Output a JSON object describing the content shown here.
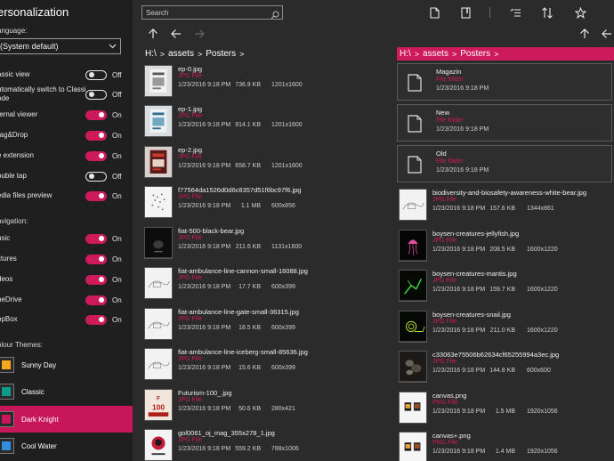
{
  "sidebar": {
    "title": "ersonalization",
    "language_label": "anguage:",
    "language_value": "(System default)",
    "options": [
      {
        "label": "assic view",
        "state": "Off",
        "on": false
      },
      {
        "label": "utomatically switch to Classic\node",
        "state": "Off",
        "on": false
      },
      {
        "label": "ternal viewer",
        "state": "On",
        "on": true
      },
      {
        "label": "rag&Drop",
        "state": "On",
        "on": true
      },
      {
        "label": "e extension",
        "state": "On",
        "on": true
      },
      {
        "label": "ouble tap",
        "state": "Off",
        "on": false
      },
      {
        "label": "edia files preview",
        "state": "On",
        "on": true
      }
    ],
    "navigation_label": "avigation:",
    "navigation": [
      {
        "label": "usic",
        "state": "On",
        "on": true
      },
      {
        "label": "ctures",
        "state": "On",
        "on": true
      },
      {
        "label": "deos",
        "state": "On",
        "on": true
      },
      {
        "label": "neDrive",
        "state": "On",
        "on": true
      },
      {
        "label": "opBox",
        "state": "On",
        "on": true
      }
    ],
    "themes_label": "olour Themes:",
    "themes": [
      {
        "name": "Sunny Day",
        "color": "#f5a81c",
        "selected": false
      },
      {
        "name": "Classic",
        "color": "#0f9c8c",
        "selected": false
      },
      {
        "name": "Dark Knight",
        "color": "#c8165a",
        "selected": true
      },
      {
        "name": "Cool Water",
        "color": "#2e8ee0",
        "selected": false
      }
    ]
  },
  "toolbar": {
    "search_placeholder": "Search",
    "icons": [
      "new-file-icon",
      "new-window-icon",
      "select-list-icon",
      "sort-icon",
      "favorite-star-icon"
    ]
  },
  "accent": "#cc1a5a",
  "left_pane": {
    "breadcrumb": [
      "H:\\",
      "assets",
      "Posters"
    ],
    "files": [
      {
        "name": "ep-0.jpg",
        "type": "JPG File",
        "date": "1/23/2016 9:18 PM",
        "size": "736.9 KB",
        "dims": "1201x1600",
        "art": "poster-grey"
      },
      {
        "name": "ep-1.jpg",
        "type": "JPG File",
        "date": "1/23/2016 9:18 PM",
        "size": "914.1 KB",
        "dims": "1201x1600",
        "art": "poster-blue"
      },
      {
        "name": "ep-2.jpg",
        "type": "JPG File",
        "date": "1/23/2016 9:18 PM",
        "size": "658.7 KB",
        "dims": "1201x1600",
        "art": "poster-red"
      },
      {
        "name": "f77564da1526d0d6c8357d51f6bc97f6.jpg",
        "type": "JPG File",
        "date": "1/23/2016 9:18 PM",
        "size": "1.1 MB",
        "dims": "600x856",
        "art": "poster-dots"
      },
      {
        "name": "fiat-500-black-bear.jpg",
        "type": "JPG File",
        "date": "1/23/2016 9:18 PM",
        "size": "211.6 KB",
        "dims": "1131x1600",
        "art": "poster-dark"
      },
      {
        "name": "fiat-ambulance-line-cannon-small-16088.jpg",
        "type": "JPG File",
        "date": "1/23/2016 9:18 PM",
        "size": "17.7 KB",
        "dims": "600x399",
        "art": "sketch"
      },
      {
        "name": "fiat-ambulance-line-gate-small-36315.jpg",
        "type": "JPG File",
        "date": "1/23/2016 9:18 PM",
        "size": "18.5 KB",
        "dims": "600x399",
        "art": "sketch"
      },
      {
        "name": "fiat-ambulance-line-iceberg-small-85636.jpg",
        "type": "JPG File",
        "date": "1/23/2016 9:18 PM",
        "size": "15.6 KB",
        "dims": "600x399",
        "art": "sketch"
      },
      {
        "name": "Futurism-100_.jpg",
        "type": "JPG File",
        "date": "1/23/2016 9:18 PM",
        "size": "50.6 KB",
        "dims": "280x421",
        "art": "poster-futurism"
      },
      {
        "name": "gol0061_oj_mag_355x278_1.jpg",
        "type": "JPG File",
        "date": "1/23/2016 9:18 PM",
        "size": "559.2 KB",
        "dims": "788x1006",
        "art": "poster-mag"
      }
    ]
  },
  "right_pane": {
    "breadcrumb": [
      "H:\\",
      "assets",
      "Posters"
    ],
    "folders": [
      {
        "name": "Magazin",
        "type": "File folder",
        "date": "1/23/2016 9:18 PM"
      },
      {
        "name": "New",
        "type": "File folder",
        "date": "1/23/2016 9:18 PM"
      },
      {
        "name": "Old",
        "type": "File folder",
        "date": "1/23/2016 9:18 PM"
      }
    ],
    "files": [
      {
        "name": "biodiversity-and-biosafety-awareness-white-bear.jpg",
        "type": "JPG File",
        "date": "1/23/2016 9:18 PM",
        "size": "157.6 KB",
        "dims": "1344x861",
        "art": "sketch"
      },
      {
        "name": "boysen-creatures-jellyfish.jpg",
        "type": "JPG File",
        "date": "1/23/2016 9:18 PM",
        "size": "208.5 KB",
        "dims": "1600x1220",
        "art": "jellyfish"
      },
      {
        "name": "boysen-creatures-mantis.jpg",
        "type": "JPG File",
        "date": "1/23/2016 9:18 PM",
        "size": "159.7 KB",
        "dims": "1600x1220",
        "art": "mantis"
      },
      {
        "name": "boysen-creatures-snail.jpg",
        "type": "JPG File",
        "date": "1/23/2016 9:18 PM",
        "size": "211.0 KB",
        "dims": "1600x1220",
        "art": "snail"
      },
      {
        "name": "c33063e75506b62634cf65255994a3ec.jpg",
        "type": "JPG File",
        "date": "1/23/2016 9:18 PM",
        "size": "144.8 KB",
        "dims": "600x600",
        "art": "rocks"
      },
      {
        "name": "canvas.png",
        "type": "PNG File",
        "date": "1/23/2016 9:18 PM",
        "size": "1.5 MB",
        "dims": "1920x1056",
        "art": "canvas"
      },
      {
        "name": "canvas+.png",
        "type": "PNG File",
        "date": "1/23/2016 9:18 PM",
        "size": "1.4 MB",
        "dims": "1920x1056",
        "art": "canvas"
      }
    ]
  }
}
